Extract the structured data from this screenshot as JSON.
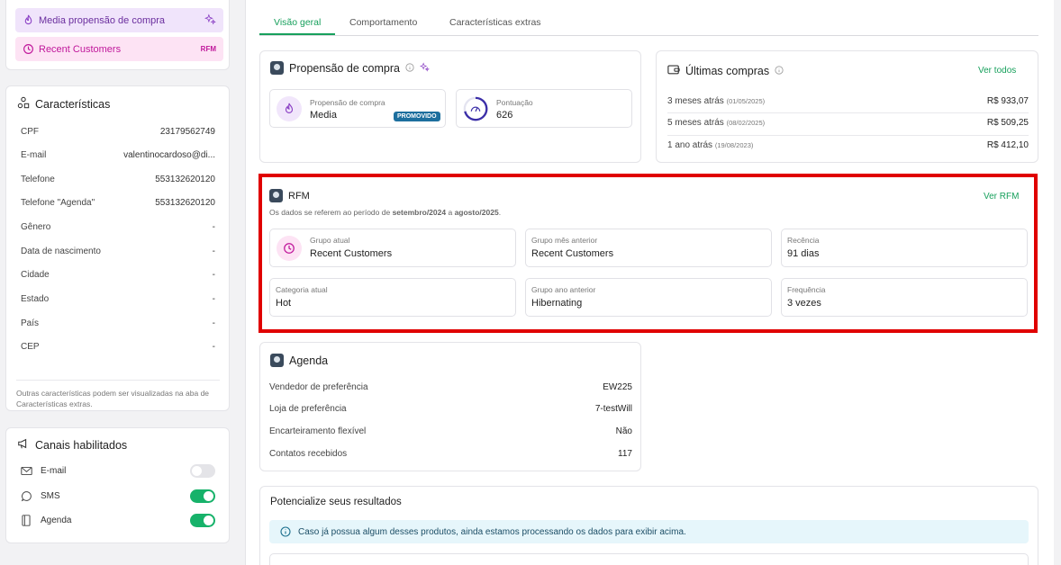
{
  "tags": [
    {
      "label": "Media propensão de compra",
      "icon": "flame-icon",
      "right_icon": "sparkles-icon"
    },
    {
      "label": "Recent Customers",
      "icon": "clock-icon",
      "right_text": "RFM"
    }
  ],
  "caracteristicas": {
    "title": "Características",
    "rows": [
      {
        "k": "CPF",
        "v": "23179562749"
      },
      {
        "k": "E-mail",
        "v": "valentinocardoso@di..."
      },
      {
        "k": "Telefone",
        "v": "553132620120"
      },
      {
        "k": "Telefone \"Agenda\"",
        "v": "553132620120"
      },
      {
        "k": "Gênero",
        "v": "-"
      },
      {
        "k": "Data de nascimento",
        "v": "-"
      },
      {
        "k": "Cidade",
        "v": "-"
      },
      {
        "k": "Estado",
        "v": "-"
      },
      {
        "k": "País",
        "v": "-"
      },
      {
        "k": "CEP",
        "v": "-"
      }
    ],
    "note": "Outras características podem ser visualizadas na aba de Características extras."
  },
  "canais": {
    "title": "Canais habilitados",
    "items": [
      {
        "label": "E-mail",
        "on": false
      },
      {
        "label": "SMS",
        "on": true
      },
      {
        "label": "Agenda",
        "on": true
      }
    ]
  },
  "tabs": [
    "Visão geral",
    "Comportamento",
    "Características extras"
  ],
  "propensao": {
    "title": "Propensão de compra",
    "box1_label": "Propensão de compra",
    "box1_value": "Media",
    "box1_badge": "PROMOVIDO",
    "box2_label": "Pontuação",
    "box2_value": "626"
  },
  "compras": {
    "title": "Últimas compras",
    "link": "Ver todos",
    "rows": [
      {
        "when": "3 meses atrás",
        "date": "(01/05/2025)",
        "price": "R$ 933,07"
      },
      {
        "when": "5 meses atrás",
        "date": "(08/02/2025)",
        "price": "R$ 509,25"
      },
      {
        "when": "1 ano atrás",
        "date": "(19/08/2023)",
        "price": "R$ 412,10"
      }
    ]
  },
  "rfm": {
    "title": "RFM",
    "link": "Ver RFM",
    "period_prefix": "Os dados se referem ao período de ",
    "period_start": "setembro/2024",
    "period_mid": " a ",
    "period_end": "agosto/2025",
    "period_suffix": ".",
    "boxes": [
      {
        "label": "Grupo atual",
        "value": "Recent Customers"
      },
      {
        "label": "Grupo mês anterior",
        "value": "Recent Customers"
      },
      {
        "label": "Recência",
        "value": "91 dias"
      },
      {
        "label": "Categoria atual",
        "value": "Hot"
      },
      {
        "label": "Grupo ano anterior",
        "value": "Hibernating"
      },
      {
        "label": "Frequência",
        "value": "3 vezes"
      }
    ]
  },
  "agenda": {
    "title": "Agenda",
    "rows": [
      {
        "k": "Vendedor de preferência",
        "v": "EW225"
      },
      {
        "k": "Loja de preferência",
        "v": "7-testWill"
      },
      {
        "k": "Encarteiramento flexível",
        "v": "Não"
      },
      {
        "k": "Contatos recebidos",
        "v": "117"
      }
    ]
  },
  "potencialize": {
    "title": "Potencialize seus resultados",
    "info": "Caso já possua algum desses produtos, ainda estamos processando os dados para exibir acima."
  },
  "colors": {
    "accent": "#17a05c",
    "highlight": "#e00000",
    "pink": "#c0179b",
    "purple": "#6a2e9e"
  }
}
